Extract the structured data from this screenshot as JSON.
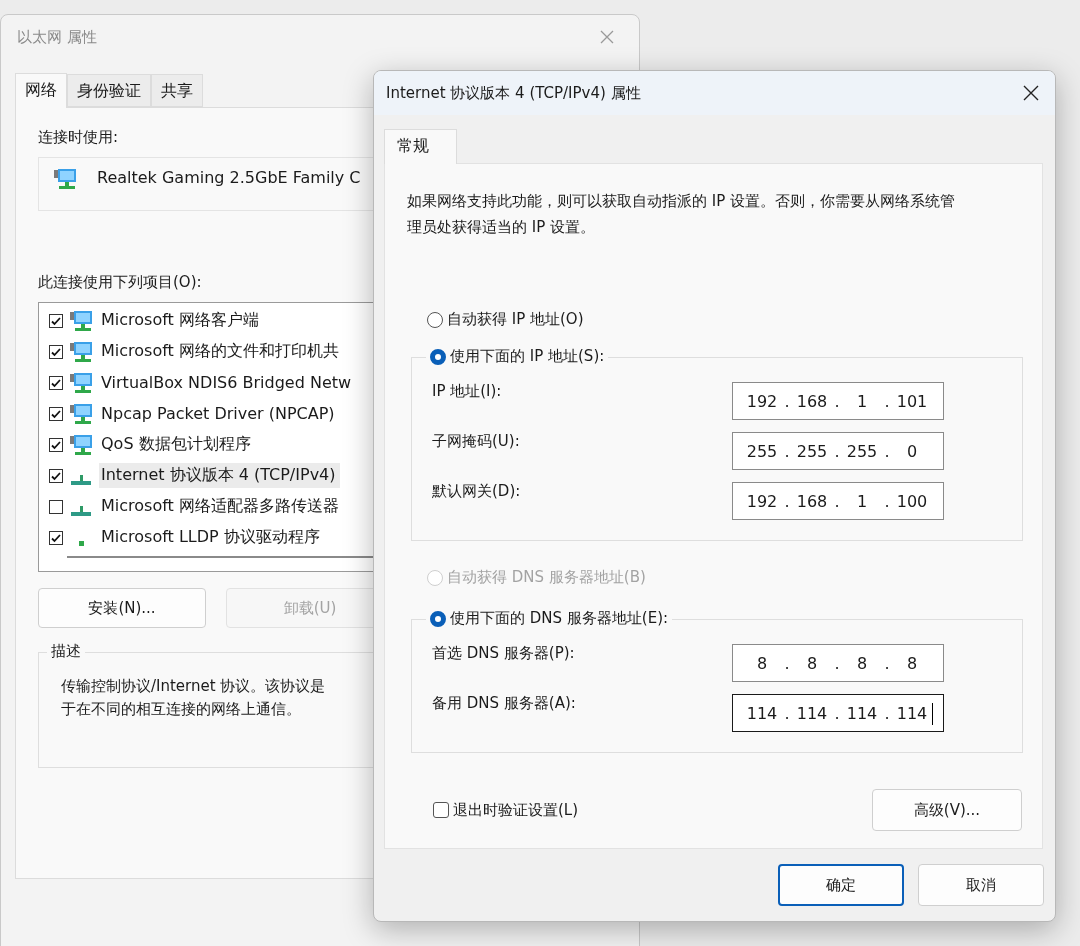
{
  "back_window": {
    "title": "以太网 属性",
    "tabs": [
      {
        "label": "网络",
        "selected": true
      },
      {
        "label": "身份验证",
        "selected": false
      },
      {
        "label": "共享",
        "selected": false
      }
    ],
    "connect_using_label": "连接时使用:",
    "adapter": "Realtek Gaming 2.5GbE Family C",
    "items_label": "此连接使用下列项目(O):",
    "items": [
      {
        "label": "Microsoft 网络客户端",
        "checked": true,
        "selected": false,
        "kind": "client"
      },
      {
        "label": "Microsoft 网络的文件和打印机共",
        "checked": true,
        "selected": false,
        "kind": "client"
      },
      {
        "label": "VirtualBox NDIS6 Bridged Netw",
        "checked": true,
        "selected": false,
        "kind": "client"
      },
      {
        "label": "Npcap Packet Driver (NPCAP)",
        "checked": true,
        "selected": false,
        "kind": "client"
      },
      {
        "label": "QoS 数据包计划程序",
        "checked": true,
        "selected": false,
        "kind": "client"
      },
      {
        "label": "Internet 协议版本 4 (TCP/IPv4)",
        "checked": true,
        "selected": true,
        "kind": "protocol"
      },
      {
        "label": "Microsoft 网络适配器多路传送器",
        "checked": false,
        "selected": false,
        "kind": "protocol"
      },
      {
        "label": "Microsoft LLDP 协议驱动程序",
        "checked": true,
        "selected": false,
        "kind": "driver"
      }
    ],
    "buttons": [
      {
        "label": "安装(N)...",
        "disabled": false
      },
      {
        "label": "卸载(U)",
        "disabled": true
      }
    ],
    "description": {
      "title": "描述",
      "lines": [
        "传输控制协议/Internet 协议。该协议是",
        "于在不同的相互连接的网络上通信。"
      ]
    }
  },
  "dialog": {
    "title": "Internet 协议版本 4 (TCP/IPv4) 属性",
    "tabs": [
      {
        "label": "常规",
        "selected": true
      }
    ],
    "intro": "如果网络支持此功能，则可以获取自动指派的 IP 设置。否则，你需要从网络系统管理员处获得适当的 IP 设置。",
    "ip_auto": {
      "label": "自动获得 IP 地址(O)",
      "selected": false,
      "disabled": false
    },
    "ip_manual": {
      "label": "使用下面的 IP 地址(S):",
      "selected": true
    },
    "ip_fields": [
      {
        "label": "IP 地址(I):",
        "octets": [
          "192",
          "168",
          "1",
          "101"
        ],
        "focused": false
      },
      {
        "label": "子网掩码(U):",
        "octets": [
          "255",
          "255",
          "255",
          "0"
        ],
        "focused": false
      },
      {
        "label": "默认网关(D):",
        "octets": [
          "192",
          "168",
          "1",
          "100"
        ],
        "focused": false
      }
    ],
    "dns_auto": {
      "label": "自动获得 DNS 服务器地址(B)",
      "selected": false,
      "disabled": true
    },
    "dns_manual": {
      "label": "使用下面的 DNS 服务器地址(E):",
      "selected": true
    },
    "dns_fields": [
      {
        "label": "首选 DNS 服务器(P):",
        "octets": [
          "8",
          "8",
          "8",
          "8"
        ],
        "focused": false
      },
      {
        "label": "备用 DNS 服务器(A):",
        "octets": [
          "114",
          "114",
          "114",
          "114"
        ],
        "focused": true
      }
    ],
    "separator": ".",
    "validate_on_exit": {
      "label": "退出时验证设置(L)",
      "checked": false
    },
    "advanced_button": "高级(V)...",
    "buttons": [
      {
        "label": "确定",
        "default": true
      },
      {
        "label": "取消",
        "default": false
      }
    ]
  }
}
